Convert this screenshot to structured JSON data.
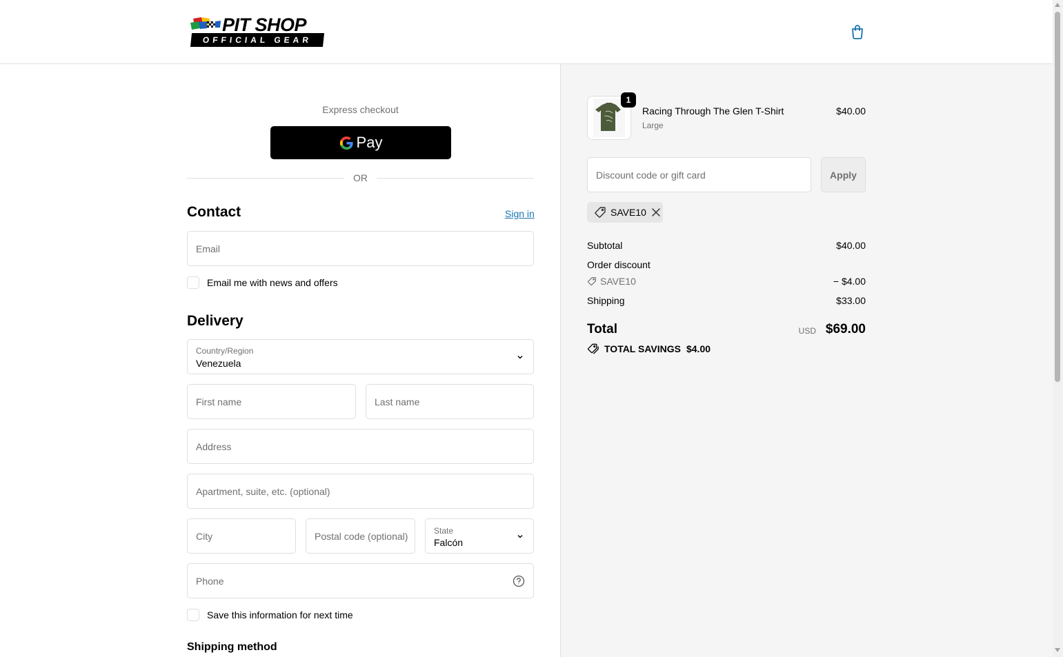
{
  "header": {
    "logo_title": "PIT SHOP",
    "logo_subtitle": "OFFICIAL GEAR",
    "cart_icon": "shopping-bag-icon"
  },
  "express": {
    "label": "Express checkout",
    "gpay_label": "Pay",
    "divider": "OR"
  },
  "contact": {
    "title": "Contact",
    "sign_in": "Sign in",
    "email_placeholder": "Email",
    "newsletter_label": "Email me with news and offers"
  },
  "delivery": {
    "title": "Delivery",
    "country_label": "Country/Region",
    "country_value": "Venezuela",
    "first_name_placeholder": "First name",
    "last_name_placeholder": "Last name",
    "address_placeholder": "Address",
    "apartment_placeholder": "Apartment, suite, etc. (optional)",
    "city_placeholder": "City",
    "postal_placeholder": "Postal code (optional)",
    "state_label": "State",
    "state_value": "Falcón",
    "phone_placeholder": "Phone",
    "save_info_label": "Save this information for next time"
  },
  "shipping_method": {
    "title": "Shipping method"
  },
  "order": {
    "item": {
      "name": "Racing Through The Glen T-Shirt",
      "variant": "Large",
      "price": "$40.00",
      "quantity": "1"
    },
    "discount_placeholder": "Discount code or gift card",
    "apply_label": "Apply",
    "applied_code": "SAVE10",
    "subtotal_label": "Subtotal",
    "subtotal_value": "$40.00",
    "order_discount_label": "Order discount",
    "discount_code": "SAVE10",
    "discount_value": "− $4.00",
    "shipping_label": "Shipping",
    "shipping_value": "$33.00",
    "total_label": "Total",
    "currency": "USD",
    "total_value": "$69.00",
    "savings_label": "TOTAL SAVINGS",
    "savings_value": "$4.00"
  },
  "colors": {
    "link": "#1773b0",
    "sidebar_bg": "#f5f5f5",
    "border": "#dedede"
  }
}
